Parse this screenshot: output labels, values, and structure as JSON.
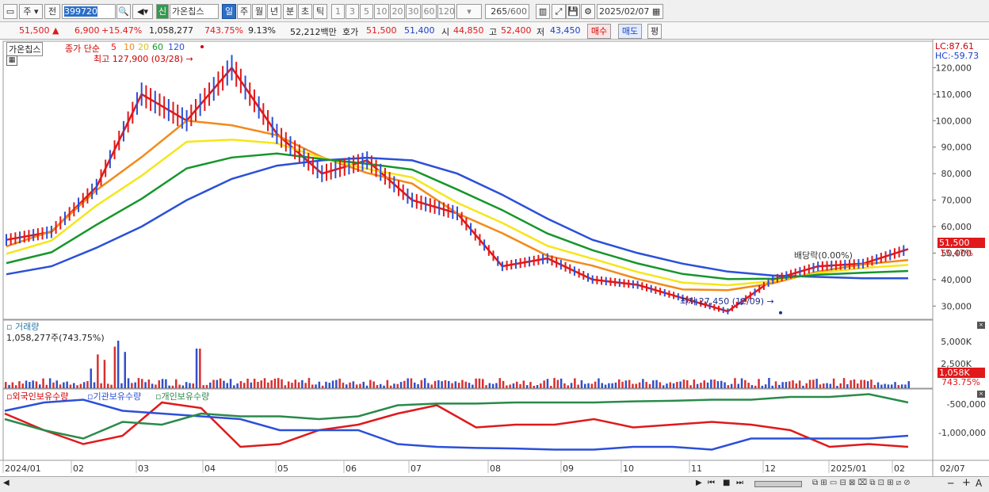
{
  "toolbar": {
    "period_select": "주",
    "prev_label": "전",
    "code": "399720",
    "new_badge": "신",
    "stock_name": "가온칩스",
    "intervals": [
      "일",
      "주",
      "월",
      "년",
      "분",
      "초",
      "틱"
    ],
    "active_interval": "일",
    "minute_options": [
      "1",
      "3",
      "5",
      "10",
      "20",
      "30",
      "60",
      "120"
    ],
    "count": "265",
    "count_total": "/600",
    "date": "2025/02/07"
  },
  "quote": {
    "price": "51,500",
    "direction_arrow": "▲",
    "change": "6,900",
    "change_pct": "+15.47%",
    "volume": "1,058,277",
    "volume_ratio": "743.75%",
    "turnover": "9.13%",
    "amount": "52,212백만",
    "hoga_label": "호가",
    "ask": "51,500",
    "bid": "51,400",
    "open_label": "시",
    "open": "44,850",
    "high_label": "고",
    "high": "52,400",
    "low_label": "저",
    "low": "43,450",
    "buy_label": "매수",
    "sell_label": "매도",
    "eval_label": "평"
  },
  "price_panel": {
    "name_tag": "가온칩스",
    "ma_label": "종가 단순",
    "ma_periods": [
      "5",
      "10",
      "20",
      "60",
      "120"
    ],
    "ma_colors": [
      "#e0191b",
      "#f28a1a",
      "#f5e61a",
      "#17962c",
      "#2b50d8"
    ],
    "high_annot": "최고 127,900 (03/28)",
    "low_annot": "최저 27,450 (12/09)",
    "dividend_annot": "배당락(0.00%)",
    "lc": "LC:87.61",
    "hc": "HC:-59.73",
    "last_price_tag": "51,500",
    "last_pct_tag": "15.47%",
    "y_ticks": [
      "120,000",
      "110,000",
      "100,000",
      "90,000",
      "80,000",
      "70,000",
      "60,000",
      "50,000",
      "40,000",
      "30,000"
    ]
  },
  "volume_panel": {
    "title": "거래량",
    "value": "1,058,277주(743.75%)",
    "y_ticks": [
      "5,000K",
      "2,500K"
    ],
    "last_tag": "1,058K",
    "last_pct": "743.75%"
  },
  "holdings_panel": {
    "labels": [
      "외국인보유수량",
      "기관보유수량",
      "개인보유수량"
    ],
    "colors": [
      "#e0191b",
      "#2b50d8",
      "#2a8a4a"
    ],
    "y_ticks": [
      "-500,000",
      "-1,000,000"
    ]
  },
  "x_axis": [
    "2024/01",
    "02",
    "03",
    "04",
    "05",
    "06",
    "07",
    "08",
    "09",
    "10",
    "11",
    "12",
    "2025/01",
    "02",
    "02/07"
  ],
  "chart_data": {
    "type": "line",
    "x_range": [
      "2024/01",
      "2025/02/07"
    ],
    "ylim": [
      25000,
      130000
    ],
    "series": [
      {
        "name": "5",
        "values": [
          55000,
          58000,
          75000,
          110000,
          100000,
          120000,
          95000,
          80000,
          85000,
          70000,
          65000,
          45000,
          48000,
          40000,
          38000,
          33000,
          28000,
          40000,
          45000,
          46000,
          51500
        ]
      },
      {
        "name": "120",
        "values": [
          42000,
          45000,
          52000,
          60000,
          70000,
          78000,
          83000,
          85000,
          86000,
          85000,
          80000,
          72000,
          63000,
          55000,
          50000,
          46000,
          43000,
          41500,
          41000,
          40500,
          40500
        ]
      }
    ],
    "highs": [
      {
        "label": "최고",
        "value": 127900,
        "date": "03/28"
      }
    ],
    "lows": [
      {
        "label": "최저",
        "value": 27450,
        "date": "12/09"
      }
    ]
  }
}
